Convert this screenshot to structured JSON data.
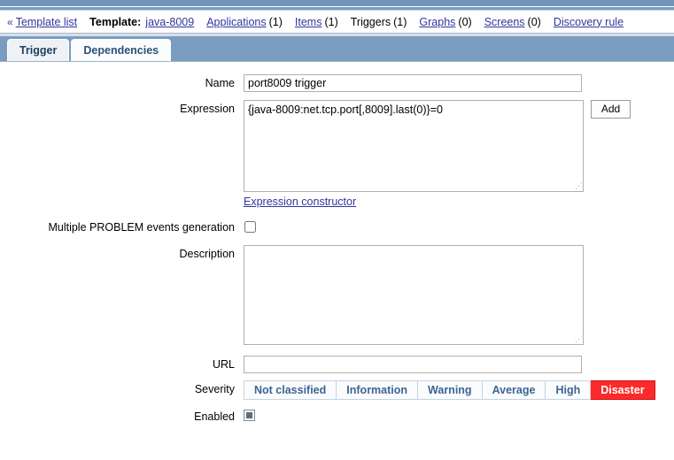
{
  "breadcrumb": {
    "back_icon": "«",
    "back_label": "Template list",
    "template_label": "Template:",
    "template_name": "java-8009",
    "items": [
      {
        "label": "Applications",
        "count": "(1)",
        "link": true
      },
      {
        "label": "Items",
        "count": "(1)",
        "link": true
      },
      {
        "label": "Triggers",
        "count": "(1)",
        "link": false
      },
      {
        "label": "Graphs",
        "count": "(0)",
        "link": true
      },
      {
        "label": "Screens",
        "count": "(0)",
        "link": true
      },
      {
        "label": "Discovery rule",
        "count": "",
        "link": true
      }
    ]
  },
  "tabs": [
    {
      "label": "Trigger",
      "selected": true
    },
    {
      "label": "Dependencies",
      "selected": false
    }
  ],
  "form": {
    "name": {
      "label": "Name",
      "value": "port8009 trigger",
      "placeholder": ""
    },
    "expression": {
      "label": "Expression",
      "value": "{java-8009:net.tcp.port[,8009].last(0)}=0",
      "placeholder": "",
      "add_button": "Add",
      "constructor_link": "Expression constructor"
    },
    "multiple_problem": {
      "label": "Multiple PROBLEM events generation",
      "checked": false
    },
    "description": {
      "label": "Description",
      "value": "",
      "placeholder": ""
    },
    "url": {
      "label": "URL",
      "value": "",
      "placeholder": ""
    },
    "severity": {
      "label": "Severity",
      "options": [
        "Not classified",
        "Information",
        "Warning",
        "Average",
        "High",
        "Disaster"
      ],
      "selected": "Disaster",
      "selected_color": "#fc2b2b"
    },
    "enabled": {
      "label": "Enabled",
      "checked": true
    }
  }
}
